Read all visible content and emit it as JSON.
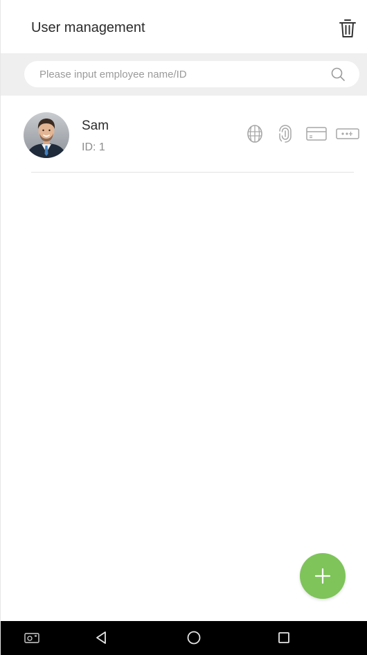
{
  "header": {
    "title": "User management",
    "delete_icon": "trash-icon"
  },
  "search": {
    "placeholder": "Please input employee name/ID",
    "value": "",
    "icon": "search-icon"
  },
  "users": [
    {
      "name": "Sam",
      "id_text": "ID: 1",
      "avatar": "avatar-photo",
      "credentials": [
        "face-icon",
        "fingerprint-icon",
        "card-icon",
        "password-icon"
      ]
    }
  ],
  "fab": {
    "icon": "plus-icon"
  },
  "navbar": {
    "items": [
      "screenshot-icon",
      "back-icon",
      "home-icon",
      "recents-icon"
    ]
  },
  "colors": {
    "accent": "#7ec45a",
    "search_band": "#efefef",
    "icon_gray": "#a6a6a6",
    "text_primary": "#2b2b2b",
    "text_secondary": "#8c8c8c",
    "navbar": "#000000"
  }
}
